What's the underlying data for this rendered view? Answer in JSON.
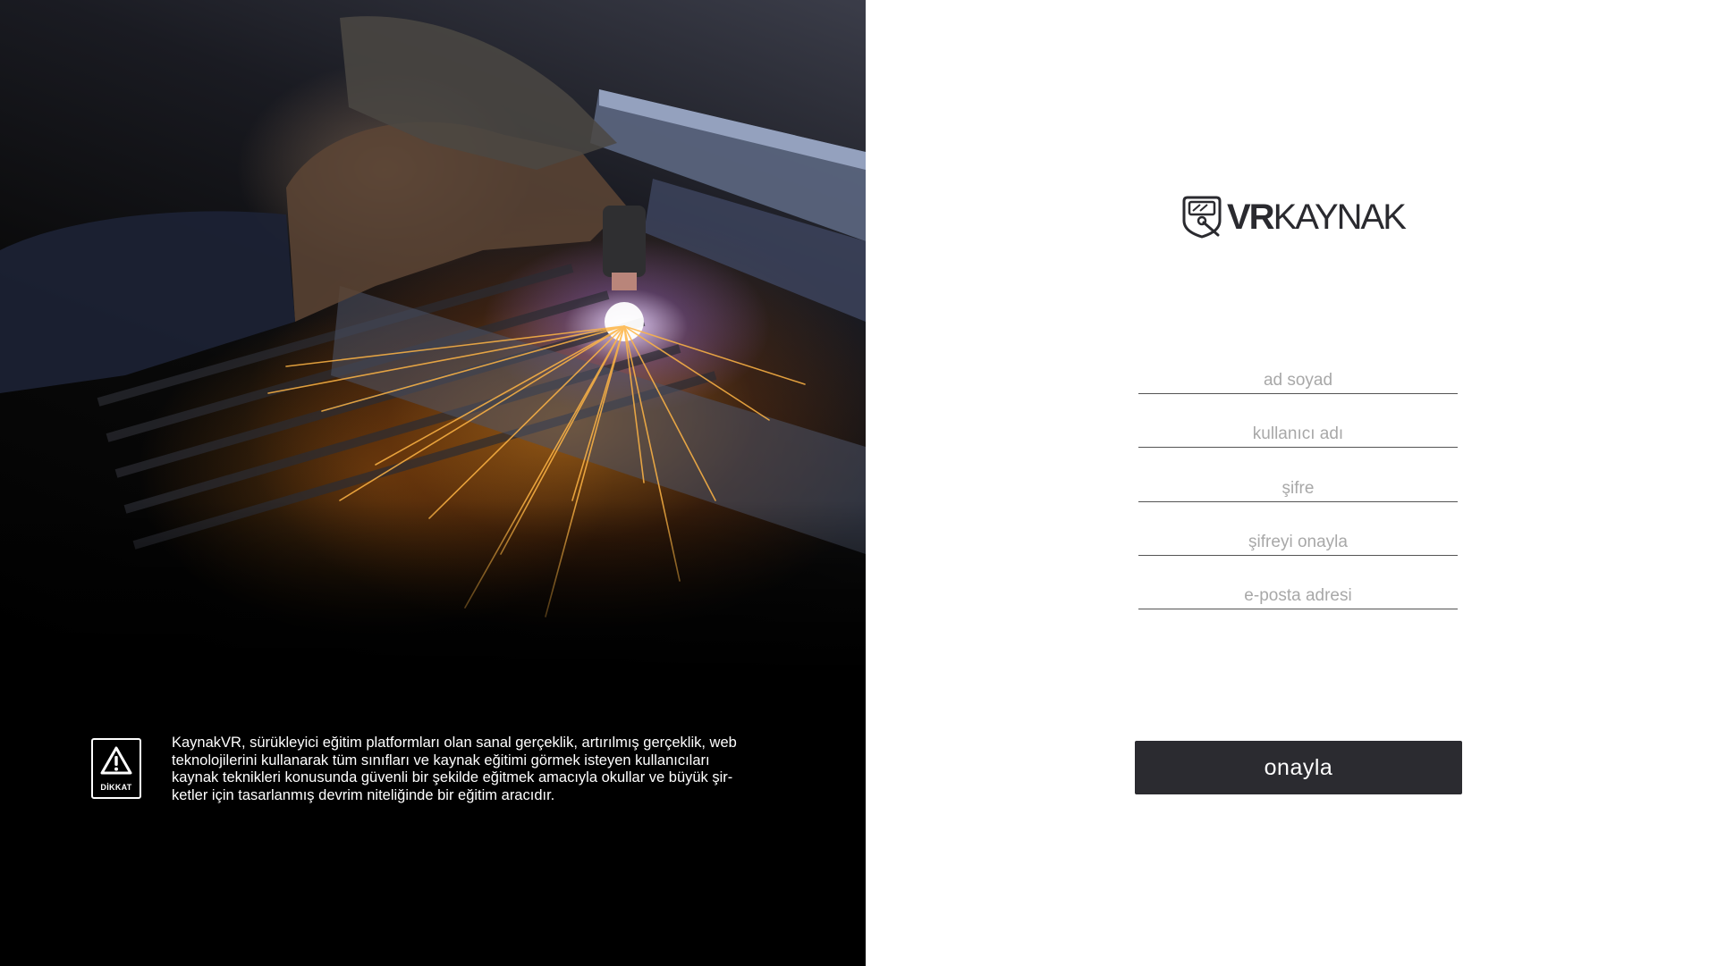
{
  "hero": {
    "description": "KaynakVR, sürükleyici eğitim platformları olan sanal gerçeklik, artırılmış gerçeklik, web\nteknolojilerini kullanarak tüm sınıfları ve kaynak eğitimi görmek isteyen kullanıcıları\nkaynak teknikleri konusunda güvenli bir şekilde eğitmek amacıyla okullar ve büyük şir-\nketler için tasarlanmış devrim niteliğinde bir eğitim aracıdır.",
    "warning_label": "DİKKAT",
    "warning_icon": "warning-triangle-icon"
  },
  "brand": {
    "logo_bold": "VR",
    "logo_rest": "KAYNAK",
    "logo_icon": "welding-helmet-icon"
  },
  "form": {
    "fields": [
      {
        "placeholder": "ad soyad",
        "value": ""
      },
      {
        "placeholder": "kullanıcı adı",
        "value": ""
      },
      {
        "placeholder": "şifre",
        "value": ""
      },
      {
        "placeholder": "şifreyi onayla",
        "value": ""
      },
      {
        "placeholder": "e-posta adresi",
        "value": ""
      }
    ],
    "submit_label": "onayla"
  },
  "colors": {
    "button_bg": "#2b2b30",
    "field_line": "#545454",
    "placeholder": "#a8a8a8"
  }
}
